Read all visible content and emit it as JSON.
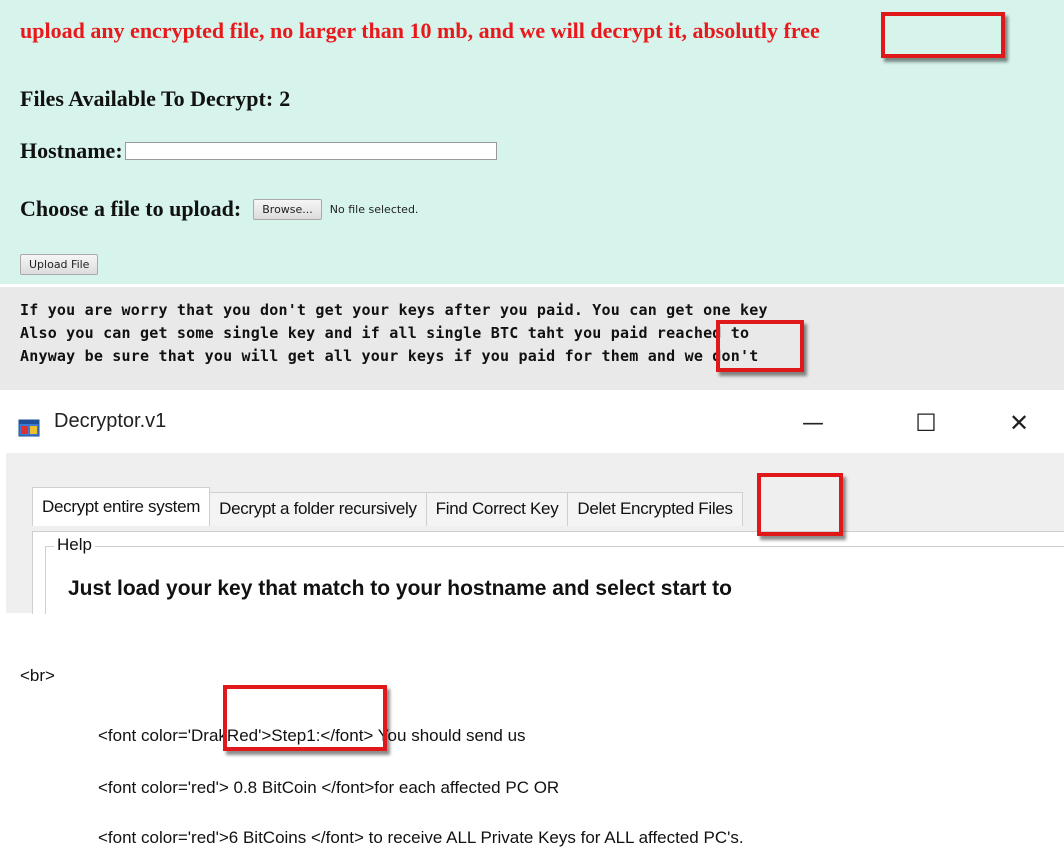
{
  "upload_page": {
    "headline": "upload any encrypted file, no larger than 10 mb, and we will decrypt it, absolutly free",
    "files_label": "Files Available To Decrypt:",
    "files_count": "2",
    "hostname_label": "Hostname:",
    "hostname_value": "",
    "choose_label": "Choose a file to upload:",
    "browse_label": "Browse...",
    "no_file_text": "No file selected.",
    "upload_label": "Upload File",
    "background": "#d6f4ec",
    "headline_color": "#e8191c"
  },
  "note": {
    "lines": [
      "If you are worry that you don't get your keys after you paid. You can get one key",
      "Also you can get some single key and if all single BTC taht you paid reached to",
      "Anyway be sure that you will get all your keys if you paid for them and we don't"
    ]
  },
  "decryptor": {
    "title": "Decryptor.v1",
    "minimize_glyph": "—",
    "maximize_glyph": "☐",
    "close_glyph": "✕",
    "tabs": [
      {
        "label": "Decrypt entire system"
      },
      {
        "label": "Decrypt a folder recursively"
      },
      {
        "label": "Find Correct Key"
      },
      {
        "label": "Delet Encrypted Files"
      }
    ],
    "group_title": "Help",
    "help_text": "Just load your key that match to your hostname and select start to"
  },
  "source": {
    "br": "<br>",
    "lines": [
      "<font color='DrakRed'>Step1:</font> You should send us",
      "<font color='red'> 0.8 BitCoin </font>for each affected PC OR",
      "<font color='red'>6 BitCoins </font> to receive ALL Private Keys for ALL affected PC's."
    ]
  },
  "highlight_color": "#e0181a"
}
